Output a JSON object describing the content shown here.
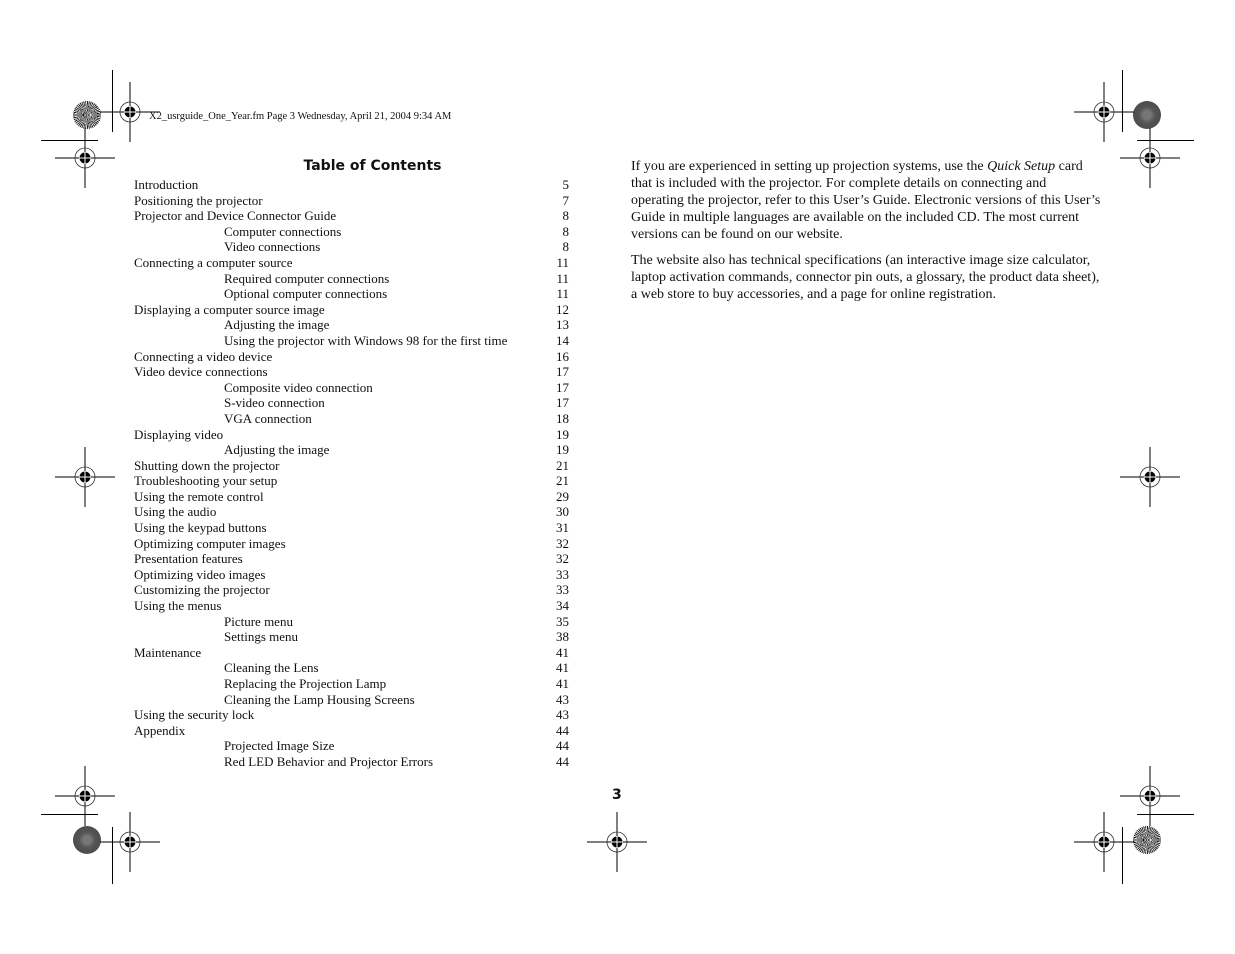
{
  "header": {
    "slug": "X2_usrguide_One_Year.fm  Page 3  Wednesday, April 21, 2004  9:34 AM"
  },
  "toc": {
    "title": "Table of Contents",
    "entries": [
      {
        "title": "Introduction",
        "page": "5",
        "level": 1
      },
      {
        "title": "Positioning the projector",
        "page": "7",
        "level": 1
      },
      {
        "title": "Projector and Device Connector Guide",
        "page": "8",
        "level": 1
      },
      {
        "title": "Computer connections",
        "page": "8",
        "level": 2
      },
      {
        "title": "Video connections",
        "page": "8",
        "level": 2
      },
      {
        "title": "Connecting a computer source",
        "page": "11",
        "level": 1
      },
      {
        "title": "Required computer connections",
        "page": "11",
        "level": 2
      },
      {
        "title": "Optional computer connections",
        "page": "11",
        "level": 2
      },
      {
        "title": "Displaying a computer source image",
        "page": "12",
        "level": 1
      },
      {
        "title": "Adjusting the image",
        "page": "13",
        "level": 2
      },
      {
        "title": "Using the projector with Windows 98 for the first time",
        "page": "14",
        "level": 2
      },
      {
        "title": "Connecting a video device",
        "page": "16",
        "level": 1
      },
      {
        "title": "Video device connections",
        "page": "17",
        "level": 1
      },
      {
        "title": "Composite video connection",
        "page": "17",
        "level": 2
      },
      {
        "title": "S-video connection",
        "page": "17",
        "level": 2
      },
      {
        "title": "VGA connection",
        "page": "18",
        "level": 2
      },
      {
        "title": "Displaying video",
        "page": "19",
        "level": 1
      },
      {
        "title": "Adjusting the image",
        "page": "19",
        "level": 2
      },
      {
        "title": "Shutting down the projector",
        "page": "21",
        "level": 1
      },
      {
        "title": "Troubleshooting your setup",
        "page": "21",
        "level": 1
      },
      {
        "title": "Using the remote control",
        "page": "29",
        "level": 1
      },
      {
        "title": "Using the audio",
        "page": "30",
        "level": 1
      },
      {
        "title": "Using the keypad buttons",
        "page": "31",
        "level": 1
      },
      {
        "title": "Optimizing computer images",
        "page": "32",
        "level": 1
      },
      {
        "title": "Presentation features",
        "page": "32",
        "level": 1
      },
      {
        "title": "Optimizing video images",
        "page": "33",
        "level": 1
      },
      {
        "title": "Customizing the projector",
        "page": "33",
        "level": 1
      },
      {
        "title": "Using the menus",
        "page": "34",
        "level": 1
      },
      {
        "title": "Picture menu",
        "page": "35",
        "level": 2
      },
      {
        "title": "Settings menu",
        "page": "38",
        "level": 2
      },
      {
        "title": "Maintenance",
        "page": "41",
        "level": 1
      },
      {
        "title": "Cleaning the Lens",
        "page": "41",
        "level": 2
      },
      {
        "title": "Replacing the Projection Lamp",
        "page": "41",
        "level": 2
      },
      {
        "title": "Cleaning the Lamp Housing Screens",
        "page": "43",
        "level": 2
      },
      {
        "title": "Using the security lock",
        "page": "43",
        "level": 1
      },
      {
        "title": "Appendix",
        "page": "44",
        "level": 1
      },
      {
        "title": "Projected Image Size",
        "page": "44",
        "level": 2
      },
      {
        "title": "Red LED Behavior and Projector Errors",
        "page": "44",
        "level": 2
      }
    ]
  },
  "body": {
    "p1_before": "If you are experienced in setting up projection systems, use the ",
    "p1_italic": "Quick Setup",
    "p1_after": " card that is included with the projector. For complete details on connecting and operating the projector, refer to this User’s Guide. Electronic versions of this User’s Guide in multiple languages are available on the included CD. The most current versions can be found on our website.",
    "p2": "The website also has technical specifications (an interactive image size calculator, laptop activation commands, connector pin outs, a glossary, the product data sheet), a web store to buy accessories, and a page for online registration."
  },
  "footer": {
    "page_number": "3"
  }
}
